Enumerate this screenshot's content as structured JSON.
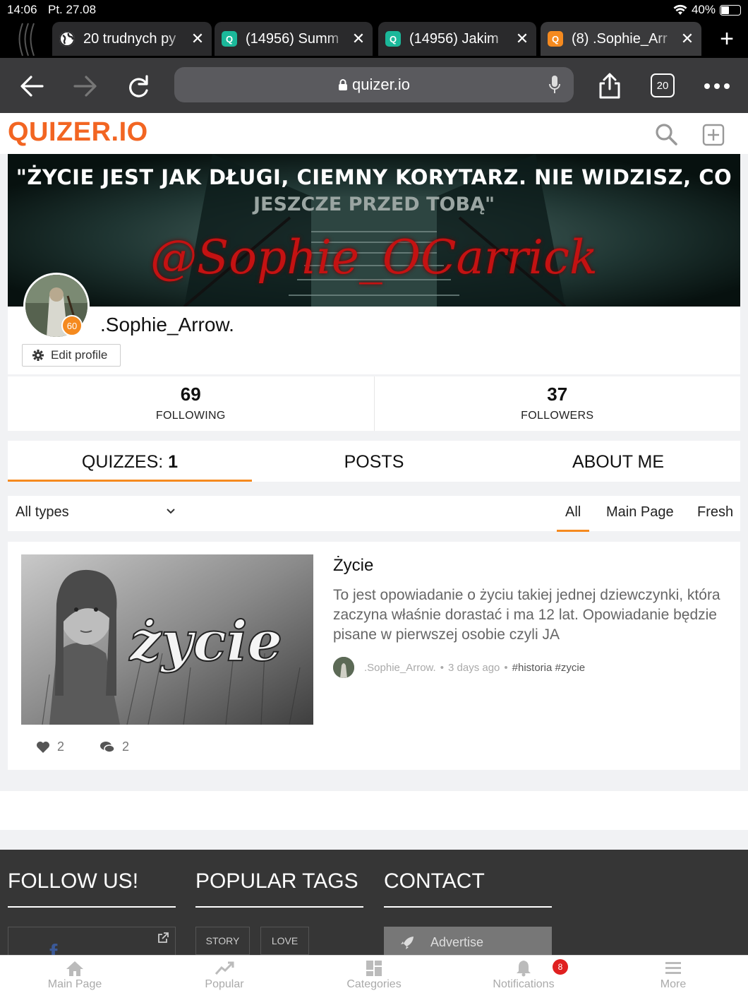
{
  "status": {
    "time": "14:06",
    "date": "Pt. 27.08",
    "battery": "40%"
  },
  "tabs": [
    {
      "title": "20 trudnych py",
      "active": false
    },
    {
      "title": "(14956) Summ",
      "active": false
    },
    {
      "title": "(14956) Jakim",
      "active": false
    },
    {
      "title": "(8) .Sophie_Arr",
      "active": true
    }
  ],
  "toolbar": {
    "url": "quizer.io",
    "tab_count": "20"
  },
  "site": {
    "logo": "QUIZER.IO"
  },
  "banner": {
    "quote_line1": "\"ŻYCIE JEST JAK DŁUGI, CIEMNY KORYTARZ. NIE WIDZISZ, CO",
    "quote_line2": "JESZCZE PRZED TOBĄ\"",
    "handle": "@Sophie_OCarrick"
  },
  "profile": {
    "level": "60",
    "username": ".Sophie_Arrow.",
    "edit_label": "Edit profile",
    "following_count": "69",
    "following_label": "FOLLOWING",
    "followers_count": "37",
    "followers_label": "FOLLOWERS"
  },
  "section_tabs": {
    "quizzes_label": "QUIZZES:",
    "quizzes_count": "1",
    "posts": "POSTS",
    "about": "ABOUT ME"
  },
  "filters": {
    "type_select": "All types",
    "all": "All",
    "main_page": "Main Page",
    "fresh": "Fresh"
  },
  "quiz": {
    "thumb_text": "życie",
    "title": "Życie",
    "description": "To jest opowiadanie o życiu takiej jednej dziewczynki, która zaczyna właśnie dorastać i ma 12 lat. Opowiadanie będzie pisane w pierwszej osobie czyli JA",
    "author": ".Sophie_Arrow.",
    "time": "3 days ago",
    "tags": "#historia #zycie",
    "likes": "2",
    "comments": "2"
  },
  "footer": {
    "follow": "FOLLOW US!",
    "popular_tags": "POPULAR TAGS",
    "contact": "CONTACT",
    "tag1": "STORY",
    "tag2": "LOVE",
    "advertise": "Advertise"
  },
  "bottom_nav": {
    "main": "Main Page",
    "popular": "Popular",
    "categories": "Categories",
    "notifications": "Notifications",
    "notif_count": "8",
    "more": "More"
  },
  "colors": {
    "accent": "#f58a1f",
    "logo": "#f26522",
    "footer_bg": "#363636"
  }
}
